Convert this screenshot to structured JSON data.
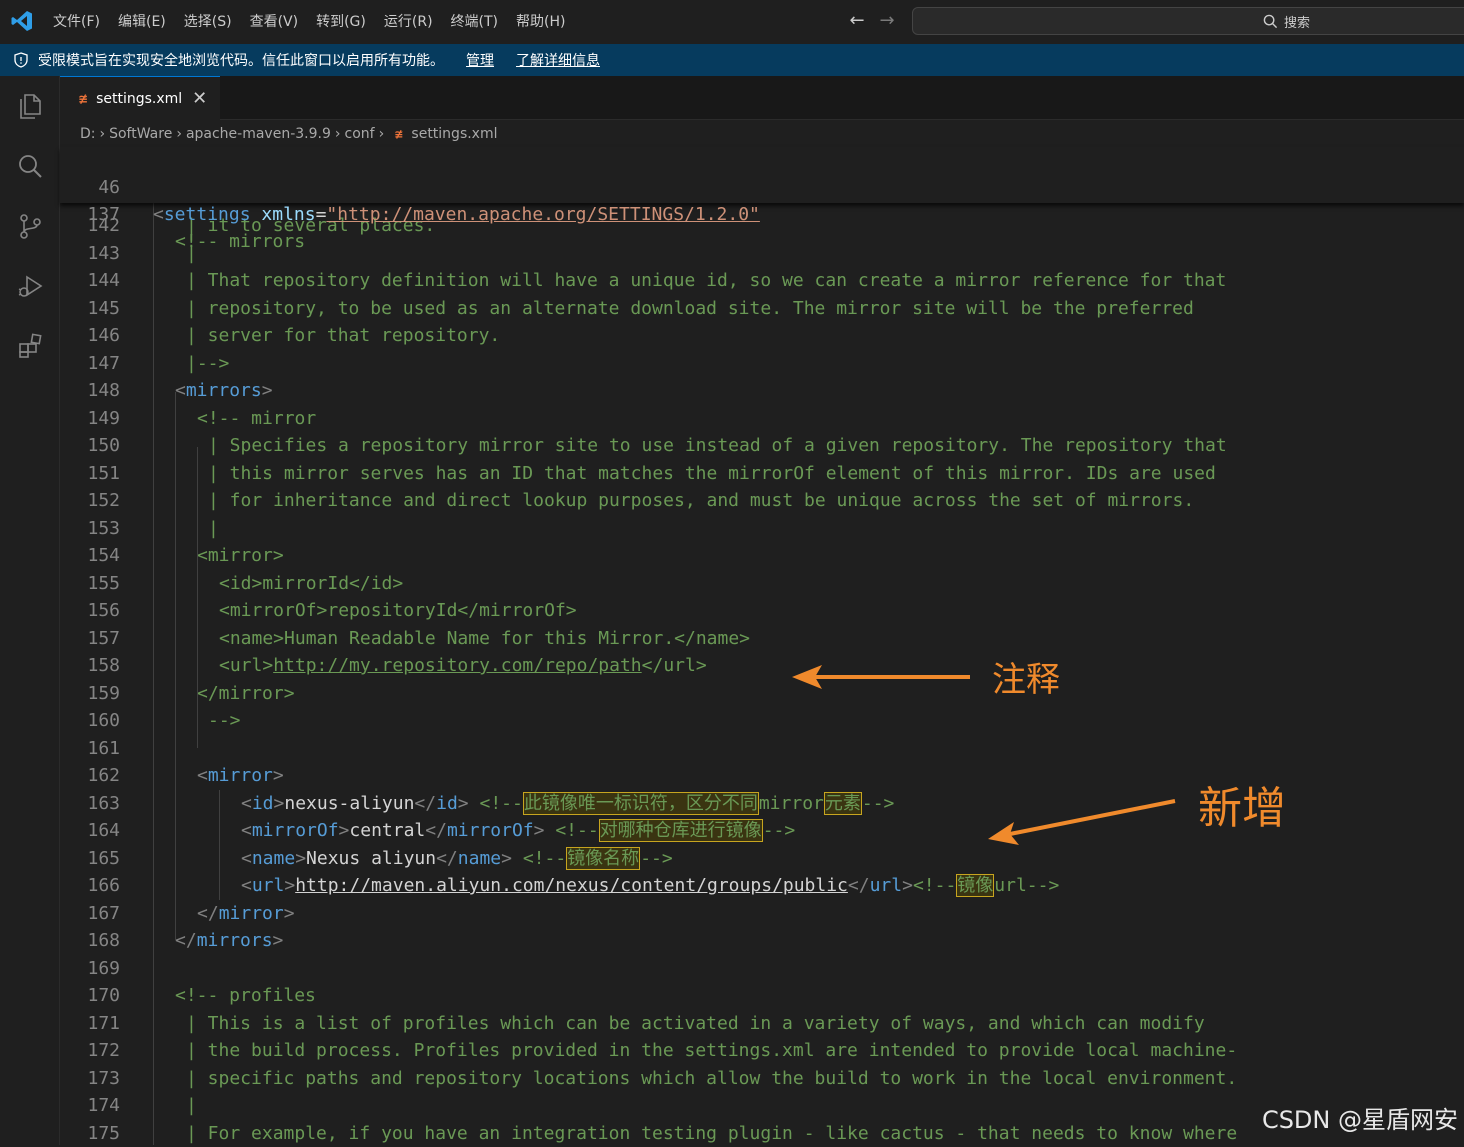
{
  "menu": [
    "文件(F)",
    "编辑(E)",
    "选择(S)",
    "查看(V)",
    "转到(G)",
    "运行(R)",
    "终端(T)",
    "帮助(H)"
  ],
  "search_label": "搜索",
  "banner": {
    "text": "受限模式旨在实现安全地浏览代码。信任此窗口以启用所有功能。",
    "manage": "管理",
    "learn_more": "了解详细信息"
  },
  "tab": {
    "name": "settings.xml"
  },
  "breadcrumb": [
    "D:",
    "SoftWare",
    "apache-maven-3.9.9",
    "conf",
    "settings.xml"
  ],
  "lines": [
    {
      "n": "46"
    },
    {
      "n": "137"
    },
    {
      "n": "142"
    },
    {
      "n": "143"
    },
    {
      "n": "144"
    },
    {
      "n": "145"
    },
    {
      "n": "146"
    },
    {
      "n": "147"
    },
    {
      "n": "148"
    },
    {
      "n": "149"
    },
    {
      "n": "150"
    },
    {
      "n": "151"
    },
    {
      "n": "152"
    },
    {
      "n": "153"
    },
    {
      "n": "154"
    },
    {
      "n": "155"
    },
    {
      "n": "156"
    },
    {
      "n": "157"
    },
    {
      "n": "158"
    },
    {
      "n": "159"
    },
    {
      "n": "160"
    },
    {
      "n": "161"
    },
    {
      "n": "162"
    },
    {
      "n": "163"
    },
    {
      "n": "164"
    },
    {
      "n": "165"
    },
    {
      "n": "166"
    },
    {
      "n": "167"
    },
    {
      "n": "168"
    },
    {
      "n": "169"
    },
    {
      "n": "170"
    },
    {
      "n": "171"
    },
    {
      "n": "172"
    },
    {
      "n": "173"
    },
    {
      "n": "174"
    },
    {
      "n": "175"
    }
  ],
  "code": {
    "l46": {
      "open": "<",
      "tag": "settings",
      "attr": "xmlns",
      "eq": "=",
      "val": "\"http://maven.apache.org/SETTINGS/1.2.0\""
    },
    "l137": "<!-- mirrors",
    "l142": "| it to several places.",
    "l143": "|",
    "l144": "| That repository definition will have a unique id, so we can create a mirror reference for that",
    "l145": "| repository, to be used as an alternate download site. The mirror site will be the preferred",
    "l146": "| server for that repository.",
    "l147": "|-->",
    "l148": {
      "open": "<",
      "tag": "mirrors",
      "close": ">"
    },
    "l149": "<!-- mirror",
    "l150": "| Specifies a repository mirror site to use instead of a given repository. The repository that",
    "l151": "| this mirror serves has an ID that matches the mirrorOf element of this mirror. IDs are used",
    "l152": "| for inheritance and direct lookup purposes, and must be unique across the set of mirrors.",
    "l153": "|",
    "l154": "<mirror>",
    "l155": "<id>mirrorId</id>",
    "l156": "<mirrorOf>repositoryId</mirrorOf>",
    "l157": "<name>Human Readable Name for this Mirror.</name>",
    "l158": {
      "pre": "<url>",
      "link": "http://my.repository.com/repo/path",
      "post": "</url>"
    },
    "l159": "</mirror>",
    "l160": "-->",
    "l162": {
      "open": "<",
      "tag": "mirror",
      "close": ">"
    },
    "l163": {
      "tag": "id",
      "value": "nexus-aliyun",
      "cmt_open": "<!--",
      "hl1": "此镜像唯一标识符，区分不同",
      "mid": "mirror",
      "hl2": "元素",
      "cmt_close": "-->"
    },
    "l164": {
      "tag": "mirrorOf",
      "value": "central",
      "cmt_open": "<!--",
      "hl1": "对哪种仓库进行镜像",
      "cmt_close": "-->"
    },
    "l165": {
      "tag": "name",
      "value": "Nexus aliyun",
      "cmt_open": "<!--",
      "hl1": "镜像名称",
      "cmt_close": "-->"
    },
    "l166": {
      "tag": "url",
      "value": "http://maven.aliyun.com/nexus/content/groups/public",
      "cmt_open": "<!--",
      "hl1": "镜像",
      "tail": "url-->"
    },
    "l167": {
      "open": "</",
      "tag": "mirror",
      "close": ">"
    },
    "l168": {
      "open": "</",
      "tag": "mirrors",
      "close": ">"
    },
    "l170": "<!-- profiles",
    "l171": "| This is a list of profiles which can be activated in a variety of ways, and which can modify",
    "l172": "| the build process. Profiles provided in the settings.xml are intended to provide local machine-",
    "l173": "| specific paths and repository locations which allow the build to work in the local environment.",
    "l174": "|",
    "l175": "| For example, if you have an integration testing plugin - like cactus - that needs to know where"
  },
  "annotations": {
    "comment_label": "注释",
    "added_label": "新增",
    "color": "#f08a2c"
  },
  "watermark": "CSDN @星盾网安"
}
